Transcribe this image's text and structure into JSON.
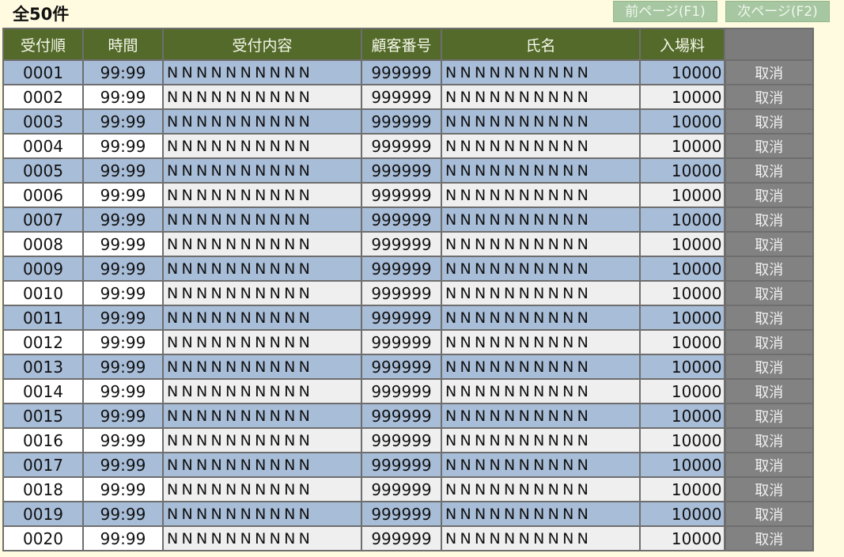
{
  "header": {
    "total_label": "全50件",
    "prev_label": "前ページ(F1)",
    "next_label": "次ページ(F2)"
  },
  "table": {
    "columns": [
      "受付順",
      "時間",
      "受付内容",
      "顧客番号",
      "氏名",
      "入場料",
      ""
    ],
    "rows": [
      {
        "seq": "0001",
        "time": "99:99",
        "content": "NNNNNNNNNN",
        "customer": "999999",
        "name": "NNNNNNNNNN",
        "fee": "10000",
        "action": "取消"
      },
      {
        "seq": "0002",
        "time": "99:99",
        "content": "NNNNNNNNNN",
        "customer": "999999",
        "name": "NNNNNNNNNN",
        "fee": "10000",
        "action": "取消"
      },
      {
        "seq": "0003",
        "time": "99:99",
        "content": "NNNNNNNNNN",
        "customer": "999999",
        "name": "NNNNNNNNNN",
        "fee": "10000",
        "action": "取消"
      },
      {
        "seq": "0004",
        "time": "99:99",
        "content": "NNNNNNNNNN",
        "customer": "999999",
        "name": "NNNNNNNNNN",
        "fee": "10000",
        "action": "取消"
      },
      {
        "seq": "0005",
        "time": "99:99",
        "content": "NNNNNNNNNN",
        "customer": "999999",
        "name": "NNNNNNNNNN",
        "fee": "10000",
        "action": "取消"
      },
      {
        "seq": "0006",
        "time": "99:99",
        "content": "NNNNNNNNNN",
        "customer": "999999",
        "name": "NNNNNNNNNN",
        "fee": "10000",
        "action": "取消"
      },
      {
        "seq": "0007",
        "time": "99:99",
        "content": "NNNNNNNNNN",
        "customer": "999999",
        "name": "NNNNNNNNNN",
        "fee": "10000",
        "action": "取消"
      },
      {
        "seq": "0008",
        "time": "99:99",
        "content": "NNNNNNNNNN",
        "customer": "999999",
        "name": "NNNNNNNNNN",
        "fee": "10000",
        "action": "取消"
      },
      {
        "seq": "0009",
        "time": "99:99",
        "content": "NNNNNNNNNN",
        "customer": "999999",
        "name": "NNNNNNNNNN",
        "fee": "10000",
        "action": "取消"
      },
      {
        "seq": "0010",
        "time": "99:99",
        "content": "NNNNNNNNNN",
        "customer": "999999",
        "name": "NNNNNNNNNN",
        "fee": "10000",
        "action": "取消"
      },
      {
        "seq": "0011",
        "time": "99:99",
        "content": "NNNNNNNNNN",
        "customer": "999999",
        "name": "NNNNNNNNNN",
        "fee": "10000",
        "action": "取消"
      },
      {
        "seq": "0012",
        "time": "99:99",
        "content": "NNNNNNNNNN",
        "customer": "999999",
        "name": "NNNNNNNNNN",
        "fee": "10000",
        "action": "取消"
      },
      {
        "seq": "0013",
        "time": "99:99",
        "content": "NNNNNNNNNN",
        "customer": "999999",
        "name": "NNNNNNNNNN",
        "fee": "10000",
        "action": "取消"
      },
      {
        "seq": "0014",
        "time": "99:99",
        "content": "NNNNNNNNNN",
        "customer": "999999",
        "name": "NNNNNNNNNN",
        "fee": "10000",
        "action": "取消"
      },
      {
        "seq": "0015",
        "time": "99:99",
        "content": "NNNNNNNNNN",
        "customer": "999999",
        "name": "NNNNNNNNNN",
        "fee": "10000",
        "action": "取消"
      },
      {
        "seq": "0016",
        "time": "99:99",
        "content": "NNNNNNNNNN",
        "customer": "999999",
        "name": "NNNNNNNNNN",
        "fee": "10000",
        "action": "取消"
      },
      {
        "seq": "0017",
        "time": "99:99",
        "content": "NNNNNNNNNN",
        "customer": "999999",
        "name": "NNNNNNNNNN",
        "fee": "10000",
        "action": "取消"
      },
      {
        "seq": "0018",
        "time": "99:99",
        "content": "NNNNNNNNNN",
        "customer": "999999",
        "name": "NNNNNNNNNN",
        "fee": "10000",
        "action": "取消"
      },
      {
        "seq": "0019",
        "time": "99:99",
        "content": "NNNNNNNNNN",
        "customer": "999999",
        "name": "NNNNNNNNNN",
        "fee": "10000",
        "action": "取消"
      },
      {
        "seq": "0020",
        "time": "99:99",
        "content": "NNNNNNNNNN",
        "customer": "999999",
        "name": "NNNNNNNNNN",
        "fee": "10000",
        "action": "取消"
      }
    ]
  },
  "colors": {
    "background": "#FFFBE1",
    "header_bg": "#546A2A",
    "row_alt": "#A8BDD8",
    "nav_button": "#A6C7A1",
    "cancel_button": "#828282"
  }
}
